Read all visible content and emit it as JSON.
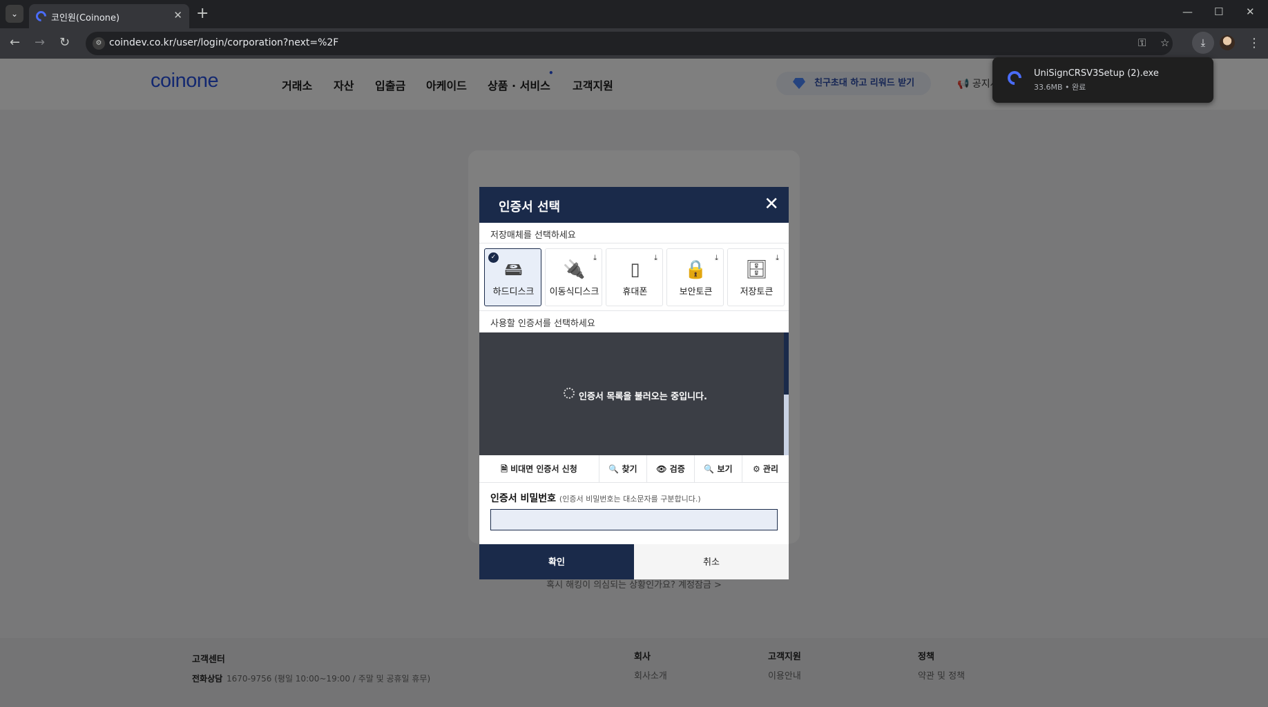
{
  "browser": {
    "tab_title": "코인원(Coinone)",
    "tab_close": "✕",
    "new_tab": "+",
    "url": "coindev.co.kr/user/login/corporation?next=%2F",
    "window_controls": [
      "—",
      "☐",
      "✕"
    ],
    "icons": [
      "chevron-down-icon",
      "back-icon",
      "forward-icon",
      "reload-icon",
      "site-info-icon",
      "key-icon",
      "star-icon",
      "download-icon",
      "profile-avatar",
      "kebab-menu-icon"
    ]
  },
  "download": {
    "filename": "UniSignCRSV3Setup (2).exe",
    "meta": "33.6MB • 완료"
  },
  "site": {
    "logo": "coinone",
    "nav": [
      "거래소",
      "자산",
      "입출금",
      "아케이드",
      "상품 · 서비스",
      "고객지원"
    ],
    "nav_badge": "•",
    "promo": "친구초대 하고 리워드 받기",
    "notice": "공지사",
    "lock_link": "혹시 해킹이 의심되는 상황인가요? 계정잠금 >",
    "footer": {
      "center_title": "고객센터",
      "center_phone_label": "전화상담",
      "center_phone": "1670-9756 (평일 10:00~19:00 / 주말 및 공휴일 휴무)",
      "company_title": "회사",
      "company_link": "회사소개",
      "support_title": "고객지원",
      "support_link": "이용안내",
      "policy_title": "정책",
      "policy_link": "약관 및 정책"
    }
  },
  "dialog": {
    "title": "인증서 선택",
    "close": "✕",
    "media_label": "저장매체를 선택하세요",
    "media": [
      {
        "label": "하드디스크",
        "icon": "hard-disk-icon",
        "selected": true
      },
      {
        "label": "이동식디스크",
        "icon": "usb-drive-icon",
        "selected": false
      },
      {
        "label": "휴대폰",
        "icon": "mobile-phone-icon",
        "selected": false
      },
      {
        "label": "보안토큰",
        "icon": "security-token-icon",
        "selected": false
      },
      {
        "label": "저장토큰",
        "icon": "storage-token-icon",
        "selected": false
      }
    ],
    "cert_label": "사용할 인증서를 선택하세요",
    "loading": "인증서 목록을 불러오는 중입니다.",
    "actions": [
      "비대면 인증서 신청",
      "찾기",
      "검증",
      "보기",
      "관리"
    ],
    "pw_label": "인증서 비밀번호",
    "pw_hint": "(인증서 비밀번호는 대소문자를 구분합니다.)",
    "pw_value": "",
    "ok": "확인",
    "cancel": "취소",
    "colors": {
      "primary": "#1a2a4a",
      "list_bg": "#3b3e45"
    }
  }
}
